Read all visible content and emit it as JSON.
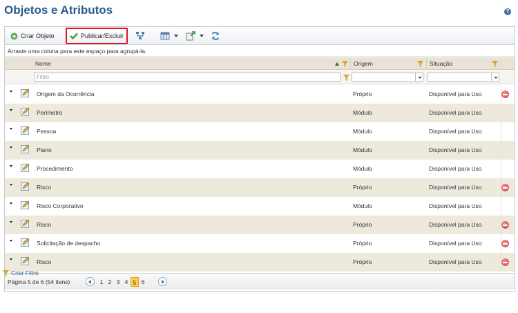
{
  "page": {
    "title": "Objetos e Atributos"
  },
  "toolbar": {
    "create_label": "Criar Objeto",
    "publish_label": "Publicar/Excluir"
  },
  "group_hint": "Arraste uma coluna para este espaço para agrupá-la.",
  "columns": {
    "name": "Nome",
    "origin": "Origem",
    "status": "Situação"
  },
  "filter": {
    "placeholder": "Filtro"
  },
  "rows": [
    {
      "name": "Origem da Ocorrência",
      "origin": "Próprio",
      "status": "Disponível para Uso",
      "deletable": true
    },
    {
      "name": "Perímetro",
      "origin": "Módulo",
      "status": "Disponível para Uso",
      "deletable": false
    },
    {
      "name": "Pessoa",
      "origin": "Módulo",
      "status": "Disponível para Uso",
      "deletable": false
    },
    {
      "name": "Plano",
      "origin": "Módulo",
      "status": "Disponível para Uso",
      "deletable": false
    },
    {
      "name": "Procedimento",
      "origin": "Módulo",
      "status": "Disponível para Uso",
      "deletable": false
    },
    {
      "name": "Risco",
      "origin": "Próprio",
      "status": "Disponível para Uso",
      "deletable": true
    },
    {
      "name": "Risco Corporativo",
      "origin": "Módulo",
      "status": "Disponível para Uso",
      "deletable": false
    },
    {
      "name": "Risco",
      "origin": "Próprio",
      "status": "Disponível para Uso",
      "deletable": true
    },
    {
      "name": "Solicitação de despacho",
      "origin": "Próprio",
      "status": "Disponível para Uso",
      "deletable": true
    },
    {
      "name": "Risco",
      "origin": "Próprio",
      "status": "Disponível para Uso",
      "deletable": true
    }
  ],
  "pager": {
    "info": "Página 5 de 6 (54 itens)",
    "pages": [
      "1",
      "2",
      "3",
      "4",
      "5",
      "6"
    ],
    "current": "5"
  },
  "footer": {
    "create_filter_label": "Criar Filtro"
  },
  "colors": {
    "title": "#2a5b8a",
    "header_bg": "#e8e3d6",
    "alt_row_bg": "#ede9dc",
    "current_page": "#ffcc52",
    "highlight_border": "#e0161b",
    "delete": "#c9403f"
  },
  "icons": {
    "help": "help-icon",
    "create": "add-circle-icon",
    "publish": "checkmark-icon",
    "hierarchy": "hierarchy-icon",
    "columns": "column-chooser-icon",
    "export": "export-icon",
    "refresh": "refresh-icon",
    "row_expand": "caret-down-icon",
    "row_edit": "edit-icon",
    "row_delete": "delete-icon",
    "filter": "funnel-icon"
  }
}
